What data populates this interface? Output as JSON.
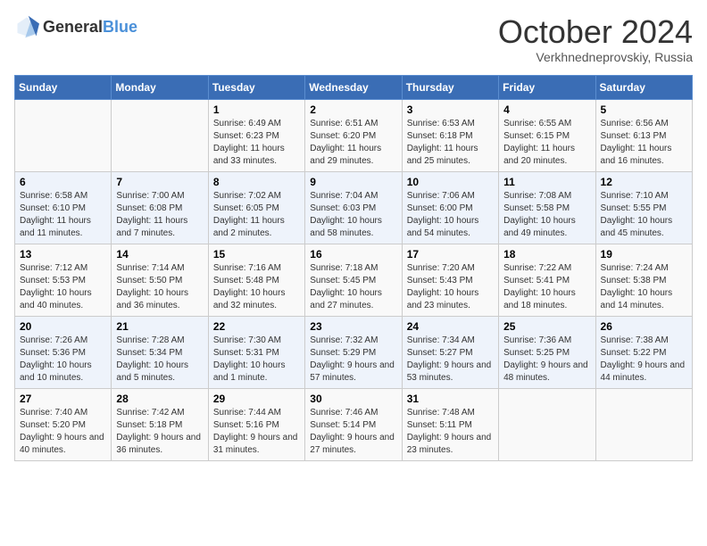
{
  "header": {
    "logo_general": "General",
    "logo_blue": "Blue",
    "month_title": "October 2024",
    "subtitle": "Verkhnedneprovskiy, Russia"
  },
  "days_of_week": [
    "Sunday",
    "Monday",
    "Tuesday",
    "Wednesday",
    "Thursday",
    "Friday",
    "Saturday"
  ],
  "weeks": [
    [
      {
        "day": "",
        "sunrise": "",
        "sunset": "",
        "daylight": ""
      },
      {
        "day": "",
        "sunrise": "",
        "sunset": "",
        "daylight": ""
      },
      {
        "day": "1",
        "sunrise": "Sunrise: 6:49 AM",
        "sunset": "Sunset: 6:23 PM",
        "daylight": "Daylight: 11 hours and 33 minutes."
      },
      {
        "day": "2",
        "sunrise": "Sunrise: 6:51 AM",
        "sunset": "Sunset: 6:20 PM",
        "daylight": "Daylight: 11 hours and 29 minutes."
      },
      {
        "day": "3",
        "sunrise": "Sunrise: 6:53 AM",
        "sunset": "Sunset: 6:18 PM",
        "daylight": "Daylight: 11 hours and 25 minutes."
      },
      {
        "day": "4",
        "sunrise": "Sunrise: 6:55 AM",
        "sunset": "Sunset: 6:15 PM",
        "daylight": "Daylight: 11 hours and 20 minutes."
      },
      {
        "day": "5",
        "sunrise": "Sunrise: 6:56 AM",
        "sunset": "Sunset: 6:13 PM",
        "daylight": "Daylight: 11 hours and 16 minutes."
      }
    ],
    [
      {
        "day": "6",
        "sunrise": "Sunrise: 6:58 AM",
        "sunset": "Sunset: 6:10 PM",
        "daylight": "Daylight: 11 hours and 11 minutes."
      },
      {
        "day": "7",
        "sunrise": "Sunrise: 7:00 AM",
        "sunset": "Sunset: 6:08 PM",
        "daylight": "Daylight: 11 hours and 7 minutes."
      },
      {
        "day": "8",
        "sunrise": "Sunrise: 7:02 AM",
        "sunset": "Sunset: 6:05 PM",
        "daylight": "Daylight: 11 hours and 2 minutes."
      },
      {
        "day": "9",
        "sunrise": "Sunrise: 7:04 AM",
        "sunset": "Sunset: 6:03 PM",
        "daylight": "Daylight: 10 hours and 58 minutes."
      },
      {
        "day": "10",
        "sunrise": "Sunrise: 7:06 AM",
        "sunset": "Sunset: 6:00 PM",
        "daylight": "Daylight: 10 hours and 54 minutes."
      },
      {
        "day": "11",
        "sunrise": "Sunrise: 7:08 AM",
        "sunset": "Sunset: 5:58 PM",
        "daylight": "Daylight: 10 hours and 49 minutes."
      },
      {
        "day": "12",
        "sunrise": "Sunrise: 7:10 AM",
        "sunset": "Sunset: 5:55 PM",
        "daylight": "Daylight: 10 hours and 45 minutes."
      }
    ],
    [
      {
        "day": "13",
        "sunrise": "Sunrise: 7:12 AM",
        "sunset": "Sunset: 5:53 PM",
        "daylight": "Daylight: 10 hours and 40 minutes."
      },
      {
        "day": "14",
        "sunrise": "Sunrise: 7:14 AM",
        "sunset": "Sunset: 5:50 PM",
        "daylight": "Daylight: 10 hours and 36 minutes."
      },
      {
        "day": "15",
        "sunrise": "Sunrise: 7:16 AM",
        "sunset": "Sunset: 5:48 PM",
        "daylight": "Daylight: 10 hours and 32 minutes."
      },
      {
        "day": "16",
        "sunrise": "Sunrise: 7:18 AM",
        "sunset": "Sunset: 5:45 PM",
        "daylight": "Daylight: 10 hours and 27 minutes."
      },
      {
        "day": "17",
        "sunrise": "Sunrise: 7:20 AM",
        "sunset": "Sunset: 5:43 PM",
        "daylight": "Daylight: 10 hours and 23 minutes."
      },
      {
        "day": "18",
        "sunrise": "Sunrise: 7:22 AM",
        "sunset": "Sunset: 5:41 PM",
        "daylight": "Daylight: 10 hours and 18 minutes."
      },
      {
        "day": "19",
        "sunrise": "Sunrise: 7:24 AM",
        "sunset": "Sunset: 5:38 PM",
        "daylight": "Daylight: 10 hours and 14 minutes."
      }
    ],
    [
      {
        "day": "20",
        "sunrise": "Sunrise: 7:26 AM",
        "sunset": "Sunset: 5:36 PM",
        "daylight": "Daylight: 10 hours and 10 minutes."
      },
      {
        "day": "21",
        "sunrise": "Sunrise: 7:28 AM",
        "sunset": "Sunset: 5:34 PM",
        "daylight": "Daylight: 10 hours and 5 minutes."
      },
      {
        "day": "22",
        "sunrise": "Sunrise: 7:30 AM",
        "sunset": "Sunset: 5:31 PM",
        "daylight": "Daylight: 10 hours and 1 minute."
      },
      {
        "day": "23",
        "sunrise": "Sunrise: 7:32 AM",
        "sunset": "Sunset: 5:29 PM",
        "daylight": "Daylight: 9 hours and 57 minutes."
      },
      {
        "day": "24",
        "sunrise": "Sunrise: 7:34 AM",
        "sunset": "Sunset: 5:27 PM",
        "daylight": "Daylight: 9 hours and 53 minutes."
      },
      {
        "day": "25",
        "sunrise": "Sunrise: 7:36 AM",
        "sunset": "Sunset: 5:25 PM",
        "daylight": "Daylight: 9 hours and 48 minutes."
      },
      {
        "day": "26",
        "sunrise": "Sunrise: 7:38 AM",
        "sunset": "Sunset: 5:22 PM",
        "daylight": "Daylight: 9 hours and 44 minutes."
      }
    ],
    [
      {
        "day": "27",
        "sunrise": "Sunrise: 7:40 AM",
        "sunset": "Sunset: 5:20 PM",
        "daylight": "Daylight: 9 hours and 40 minutes."
      },
      {
        "day": "28",
        "sunrise": "Sunrise: 7:42 AM",
        "sunset": "Sunset: 5:18 PM",
        "daylight": "Daylight: 9 hours and 36 minutes."
      },
      {
        "day": "29",
        "sunrise": "Sunrise: 7:44 AM",
        "sunset": "Sunset: 5:16 PM",
        "daylight": "Daylight: 9 hours and 31 minutes."
      },
      {
        "day": "30",
        "sunrise": "Sunrise: 7:46 AM",
        "sunset": "Sunset: 5:14 PM",
        "daylight": "Daylight: 9 hours and 27 minutes."
      },
      {
        "day": "31",
        "sunrise": "Sunrise: 7:48 AM",
        "sunset": "Sunset: 5:11 PM",
        "daylight": "Daylight: 9 hours and 23 minutes."
      },
      {
        "day": "",
        "sunrise": "",
        "sunset": "",
        "daylight": ""
      },
      {
        "day": "",
        "sunrise": "",
        "sunset": "",
        "daylight": ""
      }
    ]
  ]
}
